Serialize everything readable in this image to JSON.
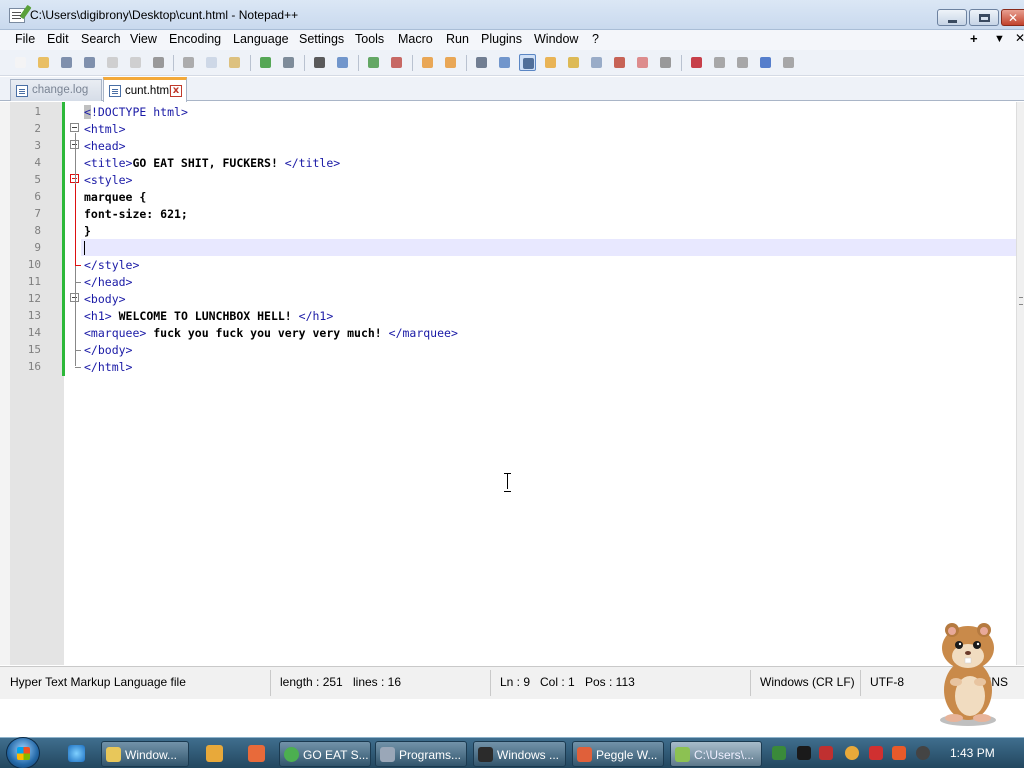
{
  "window": {
    "title": "C:\\Users\\digibrony\\Desktop\\cunt.html - Notepad++",
    "minimize_label": "",
    "maximize_label": "",
    "close_label": "✕"
  },
  "menu": {
    "items": [
      "File",
      "Edit",
      "Search",
      "View",
      "Encoding",
      "Language",
      "Settings",
      "Tools",
      "Macro",
      "Run",
      "Plugins",
      "Window",
      "?"
    ],
    "right": [
      "+",
      "▼",
      "✕"
    ]
  },
  "toolbar": {
    "icons": [
      "new-file-icon",
      "open-file-icon",
      "save-icon",
      "save-all-icon",
      "close-icon",
      "close-all-icon",
      "print-icon",
      "cut-icon",
      "copy-icon",
      "paste-icon",
      "undo-icon",
      "redo-icon",
      "find-icon",
      "replace-icon",
      "zoom-in-icon",
      "zoom-out-icon",
      "sync-vertical-icon",
      "sync-horizontal-icon",
      "word-wrap-icon",
      "show-all-chars-icon",
      "indent-guide-icon",
      "user-language-icon",
      "document-map-icon",
      "function-list-icon",
      "folder-workspace-icon",
      "monitoring-icon",
      "macro-record-icon",
      "macro-stop-icon",
      "macro-play-icon",
      "macro-run-multiple-icon",
      "macro-save-icon"
    ]
  },
  "tabs": [
    {
      "label": "change.log",
      "active": false
    },
    {
      "label": "cunt.html",
      "active": true,
      "close": "x"
    }
  ],
  "editor": {
    "lines": [
      {
        "n": "1",
        "text": "<!DOCTYPE html>"
      },
      {
        "n": "2",
        "text": "<html>"
      },
      {
        "n": "3",
        "text": "<head>"
      },
      {
        "n": "4",
        "text": "<title>GO EAT SHIT, FUCKERS! </title>"
      },
      {
        "n": "5",
        "text": "<style>"
      },
      {
        "n": "6",
        "text": "marquee {"
      },
      {
        "n": "7",
        "text": "font-size: 621;"
      },
      {
        "n": "8",
        "text": "}"
      },
      {
        "n": "9",
        "text": ""
      },
      {
        "n": "10",
        "text": "</style>"
      },
      {
        "n": "11",
        "text": "</head>"
      },
      {
        "n": "12",
        "text": "<body>"
      },
      {
        "n": "13",
        "text": "<h1> WELCOME TO LUNCHBOX HELL! </h1>"
      },
      {
        "n": "14",
        "text": "<marquee> fuck you fuck you very very much! </marquee>"
      },
      {
        "n": "15",
        "text": "</body>"
      },
      {
        "n": "16",
        "text": "</html>"
      }
    ],
    "current_line": 9
  },
  "status": {
    "file_type": "Hyper Text Markup Language file",
    "length": "length : 251",
    "lines": "lines : 16",
    "ln": "Ln : 9",
    "col": "Col : 1",
    "pos": "Pos : 113",
    "eol": "Windows (CR LF)",
    "encoding": "UTF-8",
    "mode": "INS"
  },
  "taskbar": {
    "tasks": [
      {
        "label": "Window...",
        "icon": "folder-icon",
        "color": "#e8c75a"
      },
      {
        "label": "GO EAT S...",
        "icon": "chrome-icon",
        "color": "#4caf50"
      },
      {
        "label": "Programs...",
        "icon": "programs-icon",
        "color": "#9aa7b8"
      },
      {
        "label": "Windows ...",
        "icon": "cmd-icon",
        "color": "#2b2b2b"
      },
      {
        "label": "Peggle W...",
        "icon": "peggle-icon",
        "color": "#e0603a"
      },
      {
        "label": "C:\\Users\\...",
        "icon": "notepadpp-icon",
        "color": "#8cc152",
        "active": true
      }
    ],
    "clock": "1:43 PM"
  },
  "colors": {
    "tag": "#1a1aa6",
    "change_bar": "#2db83a",
    "active_tab_accent": "#f3a93a",
    "caret_line": "#e8e8ff"
  }
}
